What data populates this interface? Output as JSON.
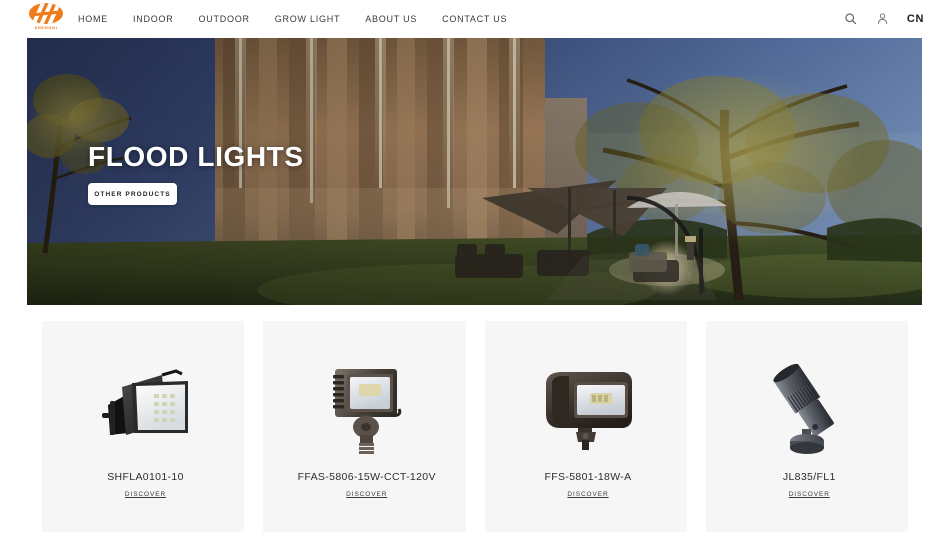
{
  "header": {
    "logo": {
      "icon": "company-logo-icon",
      "wordmark": "SHENGNI",
      "accent_color": "#ef7c1a"
    },
    "nav": [
      {
        "label": "HOME"
      },
      {
        "label": "INDOOR"
      },
      {
        "label": "OUTDOOR"
      },
      {
        "label": "GROW LIGHT"
      },
      {
        "label": "ABOUT US"
      },
      {
        "label": "CONTACT US"
      }
    ],
    "search_icon": "search-icon",
    "account_icon": "user-icon",
    "language": "CN"
  },
  "hero": {
    "title": "FLOOD LIGHTS",
    "button_label": "OTHER PRODUCTS",
    "scene": "night outdoor landscape with illuminated building facade, lit trees, lawn and patio umbrellas"
  },
  "products": [
    {
      "name": "SHFLA0101-10",
      "link_label": "DISCOVER",
      "image": "slim-flood-light-black"
    },
    {
      "name": "FFAS-5806-15W-CCT-120V",
      "link_label": "DISCOVER",
      "image": "knuckle-mount-flood-light-bronze"
    },
    {
      "name": "FFS-5801-18W-A",
      "link_label": "DISCOVER",
      "image": "wide-rectangular-flood-light-bronze"
    },
    {
      "name": "JL835/FL1",
      "link_label": "DISCOVER",
      "image": "angled-spot-light-gray"
    }
  ],
  "colors": {
    "card_background": "#f6f6f6",
    "page_background": "#ffffff",
    "text": "#2d2d2d",
    "brand_orange": "#ef7c1a"
  }
}
